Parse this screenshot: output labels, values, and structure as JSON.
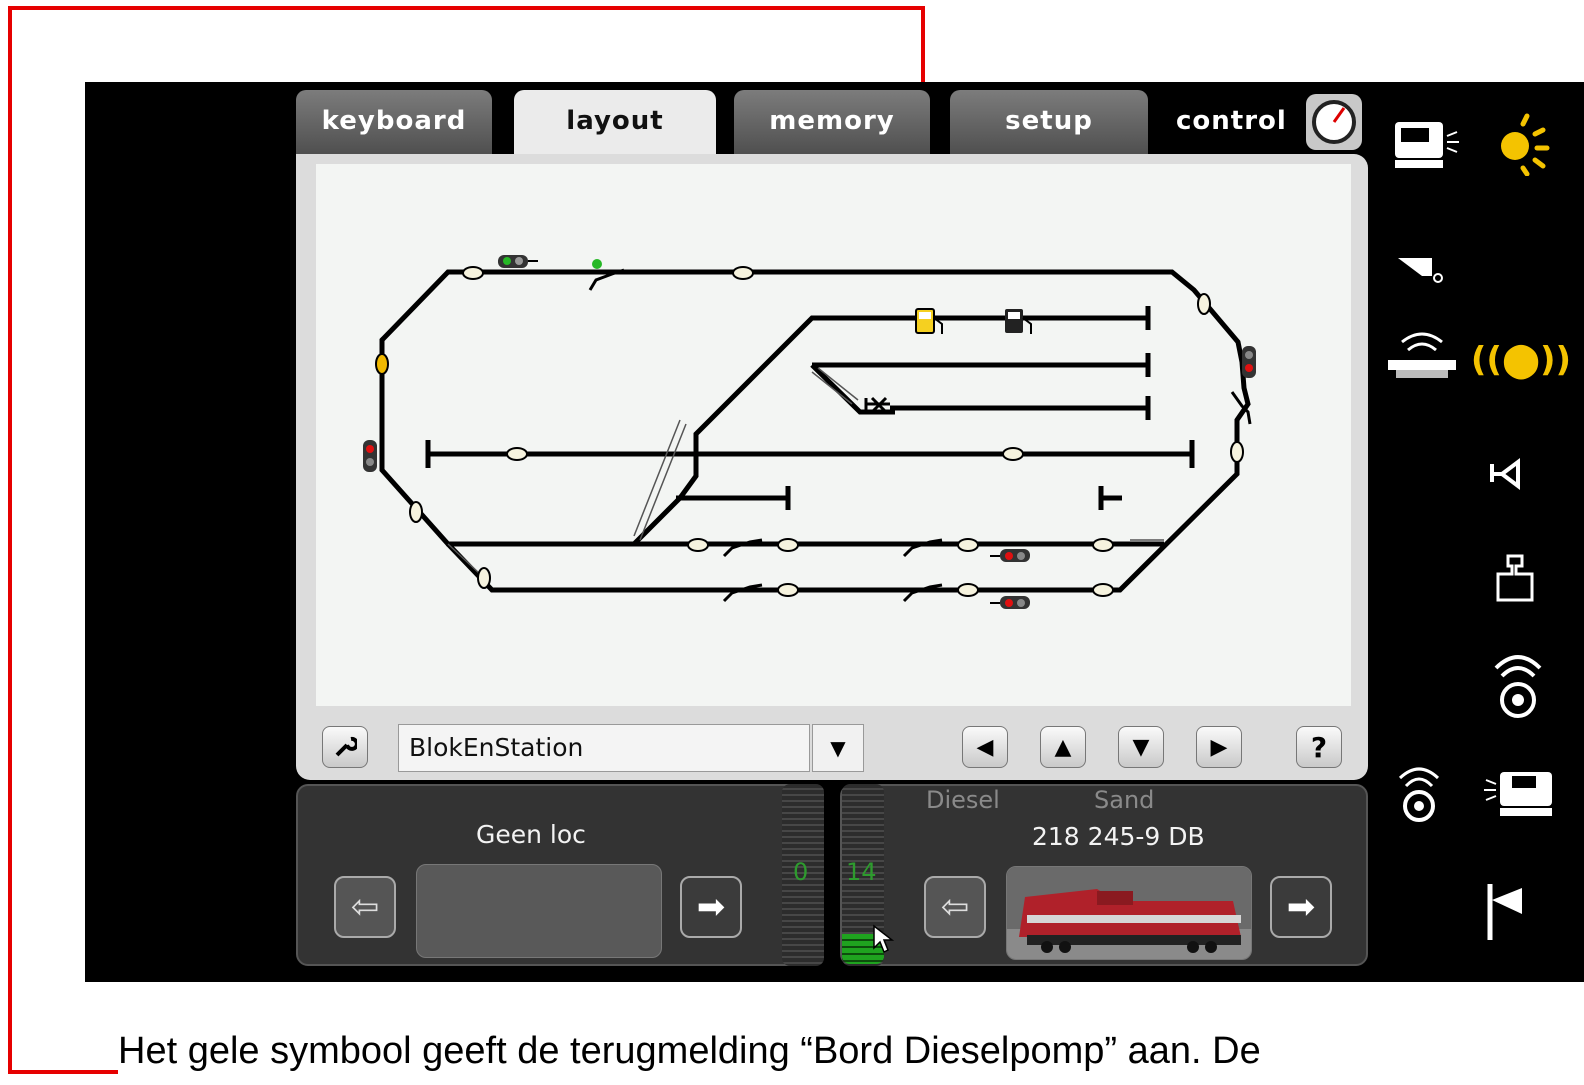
{
  "tabs": [
    {
      "label": "keyboard",
      "active": false
    },
    {
      "label": "layout",
      "active": true
    },
    {
      "label": "memory",
      "active": false
    },
    {
      "label": "setup",
      "active": false
    },
    {
      "label": "control",
      "active": false
    }
  ],
  "layout_toolbar": {
    "layout_name": "BlokEnStation",
    "help_label": "?"
  },
  "cab_left": {
    "loco_name": "Geen loc",
    "speed_value": "0"
  },
  "cab_right": {
    "function_1": "Diesel",
    "function_2": "Sand",
    "loco_name": "218 245-9 DB",
    "speed_value": "14"
  },
  "side_icons": [
    "loco-light-icon",
    "sun-light-icon",
    "whistle-icon",
    "radio-station-icon",
    "sound-icon",
    "horn-icon",
    "weight-icon",
    "radio-signal-icon",
    "loco-icon",
    "flag-icon"
  ],
  "colors": {
    "annotation": "#e60000",
    "highlight_symbol": "#f5d020",
    "speed_bar": "#1fa31f"
  },
  "caption": "Het gele symbool geeft de terugmelding “Bord Dieselpomp” aan. De"
}
